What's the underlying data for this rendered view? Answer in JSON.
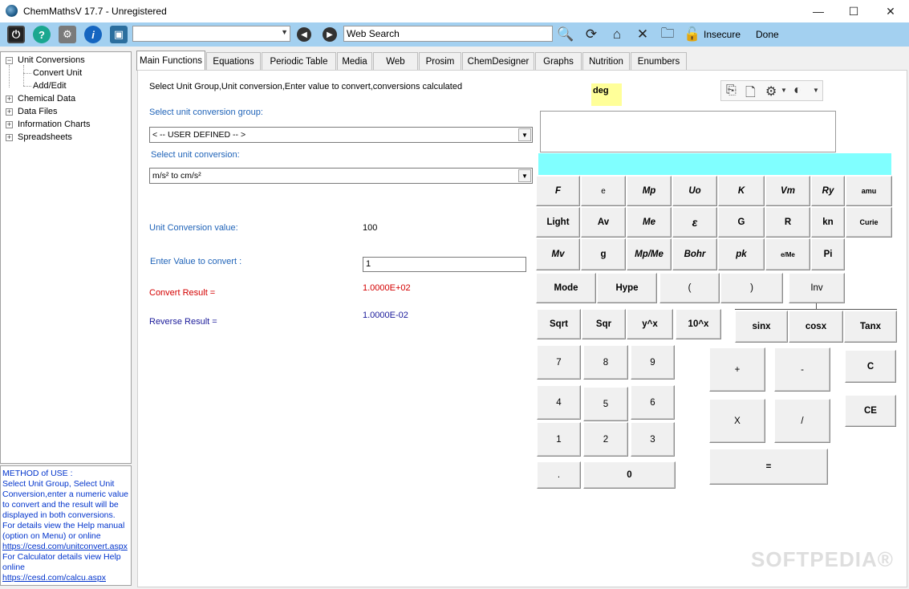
{
  "window": {
    "title": "ChemMathsV 17.7 - Unregistered",
    "minimize": "—",
    "maximize": "☐",
    "close": "✕"
  },
  "toolbar": {
    "address": "Web Search",
    "insecure_label": "Insecure",
    "done_label": "Done"
  },
  "tree": {
    "items": [
      {
        "label": "Unit Conversions",
        "expanded": true
      },
      {
        "label": "Convert Unit"
      },
      {
        "label": "Add/Edit"
      },
      {
        "label": "Chemical Data"
      },
      {
        "label": "Data Files"
      },
      {
        "label": "Information Charts"
      },
      {
        "label": "Spreadsheets"
      }
    ]
  },
  "help": {
    "lines": [
      "METHOD of USE :",
      "Select Unit Group, Select Unit",
      "Conversion,enter a numeric value",
      "to convert and the result will be",
      "displayed in both conversions.",
      " For details view the Help manual",
      "(option on Menu) or online",
      "https://cesd.com/unitconvert.aspx",
      "For Calculator details view Help",
      "online",
      "https://cesd.com/calcu.aspx"
    ]
  },
  "tabs": [
    "Main Functions",
    "Equations",
    "Periodic Table",
    "Media",
    "Web",
    "Prosim",
    "ChemDesigner",
    "Graphs",
    "Nutrition",
    "Enumbers"
  ],
  "main": {
    "instruction": "Select Unit Group,Unit conversion,Enter value to convert,conversions calculated",
    "group_label": "Select unit conversion group:",
    "group_value": "< -- USER DEFINED -- >",
    "conversion_label": "Select unit conversion:",
    "conversion_value": "m/s² to cm/s²",
    "ucv_label": "Unit Conversion value:",
    "ucv_value": "100",
    "enter_label": "Enter Value to convert :",
    "enter_value": "1",
    "convert_label": "Convert Result =",
    "convert_value": "1.0000E+02",
    "reverse_label": "Reverse Result =",
    "reverse_value": "1.0000E-02"
  },
  "calculator": {
    "angle_mode": "deg",
    "const_row1": [
      "F",
      "e",
      "Mp",
      "Uo",
      "K",
      "Vm",
      "Ry",
      "amu"
    ],
    "const_row2": [
      "Light",
      "Av",
      "Me",
      "ε",
      "G",
      "R",
      "kn",
      "Curie"
    ],
    "const_row3": [
      "Mv",
      "g",
      "Mp/Me",
      "Bohr",
      "pk",
      "e/Me",
      "Pi"
    ],
    "fn_row1": [
      "Mode",
      "Hype",
      "(",
      ")",
      "Inv"
    ],
    "fn_row2": [
      "Sqrt",
      "Sqr",
      "y^x",
      "10^x",
      "sinx",
      "cosx",
      "Tanx"
    ],
    "digits": [
      "7",
      "8",
      "9",
      "4",
      "5",
      "6",
      "1",
      "2",
      "3",
      ".",
      "0"
    ],
    "ops": [
      "+",
      "-",
      "X",
      "/",
      "="
    ],
    "clear": [
      "C",
      "CE"
    ]
  },
  "watermark": "SOFTPEDIA®"
}
